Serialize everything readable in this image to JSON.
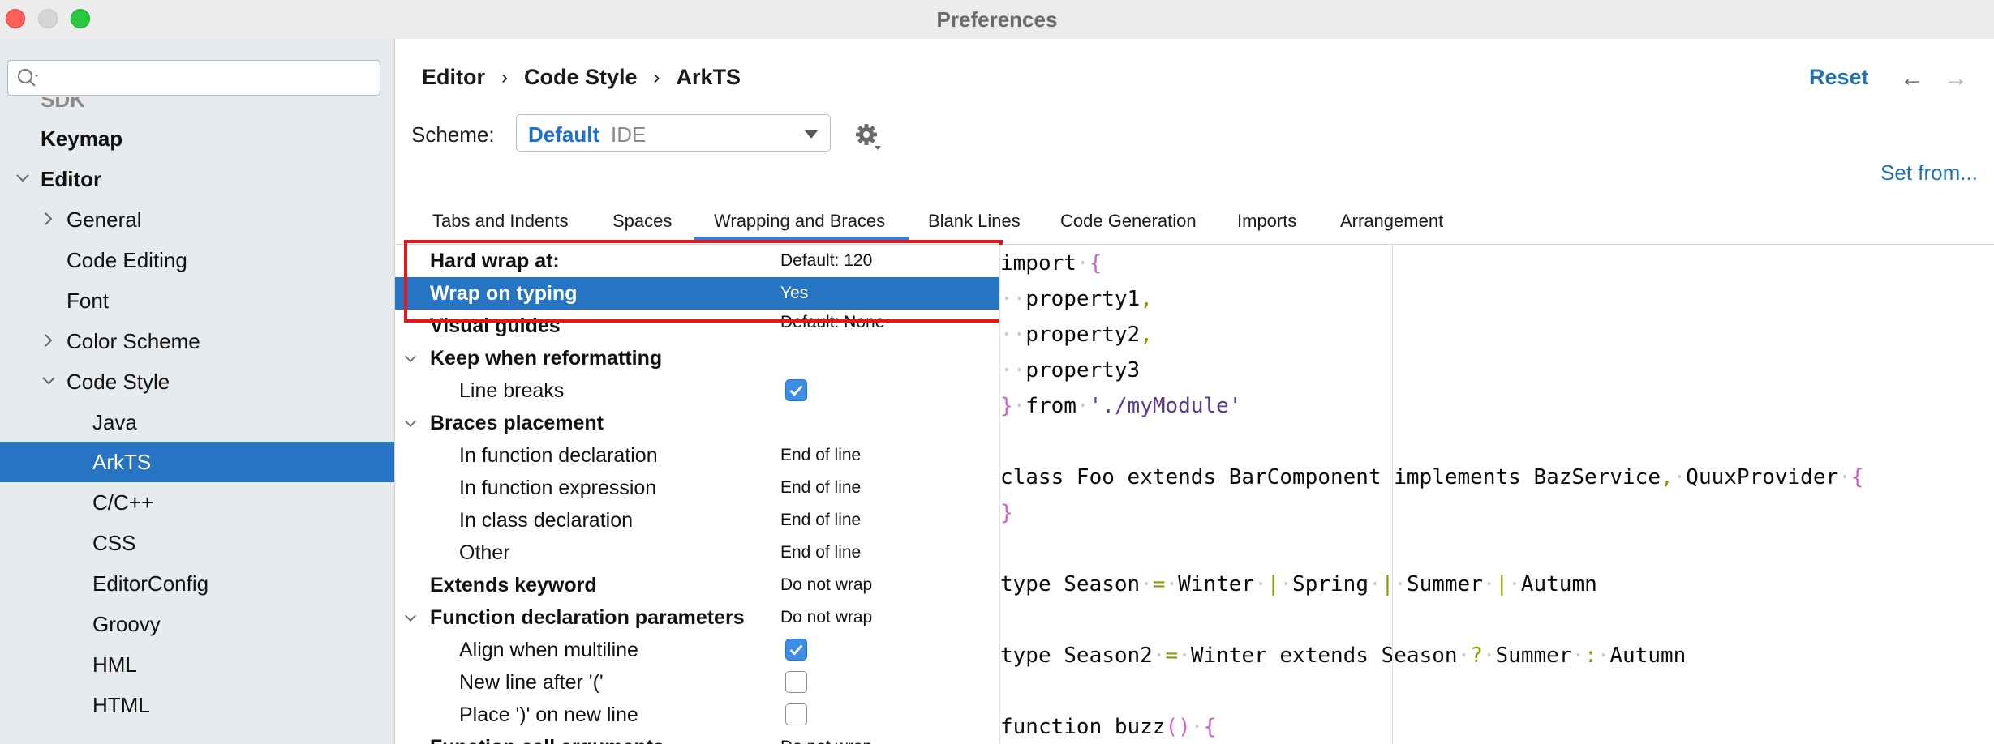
{
  "window": {
    "title": "Preferences"
  },
  "sidebar": {
    "search_placeholder": "",
    "items": {
      "sdk": "SDK",
      "keymap": "Keymap",
      "editor": "Editor",
      "general": "General",
      "code_editing": "Code Editing",
      "font": "Font",
      "color_scheme": "Color Scheme",
      "code_style": "Code Style",
      "java": "Java",
      "arkts": "ArkTS",
      "cpp": "C/C++",
      "css": "CSS",
      "editorconfig": "EditorConfig",
      "groovy": "Groovy",
      "hml": "HML",
      "html": "HTML"
    }
  },
  "header": {
    "breadcrumb": [
      "Editor",
      "Code Style",
      "ArkTS"
    ],
    "reset": "Reset",
    "back": "←",
    "forward": "→",
    "scheme_label": "Scheme:",
    "scheme_name": "Default",
    "scheme_type": "IDE",
    "set_from": "Set from..."
  },
  "tabs": {
    "tabs_indents": "Tabs and Indents",
    "spaces": "Spaces",
    "wrapping": "Wrapping and Braces",
    "blank_lines": "Blank Lines",
    "code_generation": "Code Generation",
    "imports": "Imports",
    "arrangement": "Arrangement",
    "active": "Wrapping and Braces"
  },
  "settings": {
    "hard_wrap": {
      "label": "Hard wrap at:",
      "value": "Default: 120"
    },
    "wrap_typing": {
      "label": "Wrap on typing",
      "value": "Yes"
    },
    "visual_guides": {
      "label": "Visual guides",
      "value": "Default: None"
    },
    "keep_reformat": {
      "label": "Keep when reformatting"
    },
    "line_breaks": {
      "label": "Line breaks",
      "checked": true
    },
    "braces_placement": {
      "label": "Braces placement"
    },
    "in_func_decl": {
      "label": "In function declaration",
      "value": "End of line"
    },
    "in_func_expr": {
      "label": "In function expression",
      "value": "End of line"
    },
    "in_class_decl": {
      "label": "In class declaration",
      "value": "End of line"
    },
    "other": {
      "label": "Other",
      "value": "End of line"
    },
    "extends_kw": {
      "label": "Extends keyword",
      "value": "Do not wrap"
    },
    "func_decl_params": {
      "label": "Function declaration parameters",
      "value": "Do not wrap"
    },
    "align_multiline": {
      "label": "Align when multiline",
      "checked": true
    },
    "new_line_after": {
      "label": "New line after '('",
      "checked": false
    },
    "place_paren": {
      "label": "Place ')' on new line",
      "checked": false
    },
    "func_call_args": {
      "label": "Function call arguments",
      "value": "Do not wrap"
    }
  },
  "code": {
    "l1_kw": "import",
    "l1_br": "{",
    "l2": "property1",
    "l3": "property2",
    "l4": "property3",
    "l5_br": "}",
    "l5_from": "from",
    "l5_str": "'./myModule'",
    "l6": "class Foo extends BarComponent implements BazService",
    "l6b": "QuuxProvider",
    "l7": "}",
    "l8a": "type Season",
    "l8b": "Winter",
    "l8c": "Spring",
    "l8d": "Summer",
    "l8e": "Autumn",
    "l9a": "type Season2",
    "l9b": "Winter extends Season",
    "l9c": "Summer",
    "l9d": "Autumn",
    "l10a": "function buzz",
    "l10b": "()",
    "l10c": "{",
    "comma": ",",
    "eq": "=",
    "pipe": "|",
    "q": "?",
    "colon": ":"
  },
  "colors": {
    "selection": "#2774c2",
    "link": "#2470b3",
    "highlight_box": "#e8141a",
    "brace": "#cc62c7",
    "punct": "#8a9a00"
  }
}
